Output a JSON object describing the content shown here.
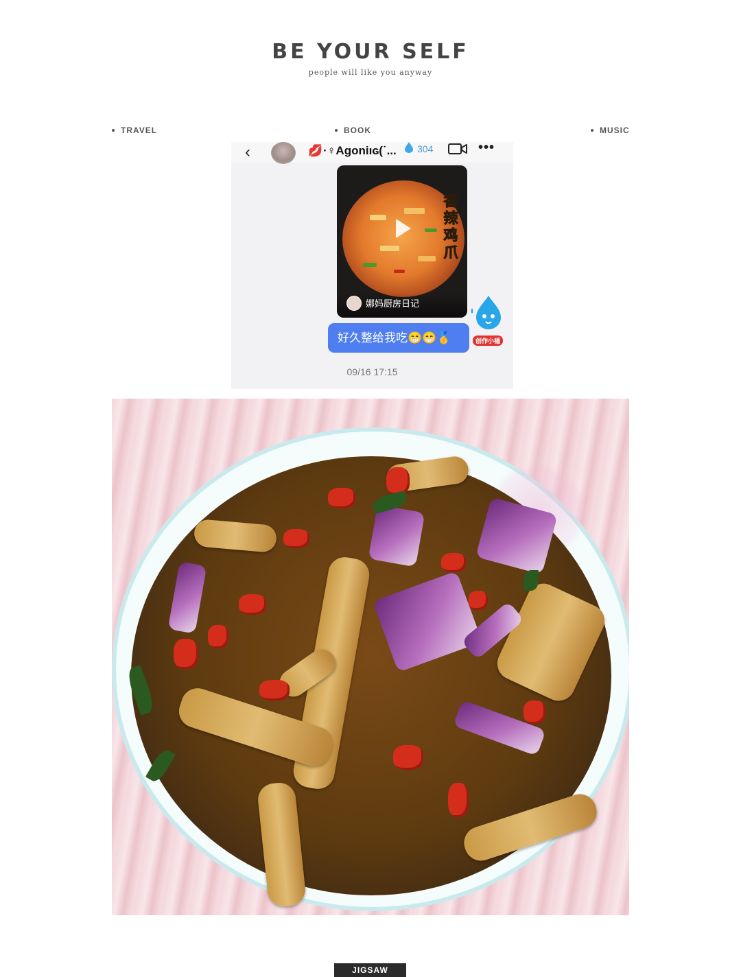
{
  "header": {
    "title": "BE YOUR SELF",
    "subtitle": "people will like you anyway"
  },
  "nav": {
    "items": [
      {
        "label": "TRAVEL"
      },
      {
        "label": "BOOK"
      },
      {
        "label": "MUSIC"
      }
    ]
  },
  "chat": {
    "contact_name": "·♀Agoniıɢ(˙...",
    "fire_count": "304",
    "video": {
      "caption": "香辣鸡爪",
      "author": "娜妈厨房日记"
    },
    "mascot_badge": "创作小福",
    "message": "好久整给我吃😁😁🥇",
    "timestamp": "09/16 17:15",
    "colors": {
      "bubble": "#4e7ef0",
      "count": "#4a9ad6"
    }
  },
  "photo": {
    "subject": "braised chicken feet with eggplant and chili peppers"
  },
  "footer": {
    "badge": "JIGSAW"
  }
}
